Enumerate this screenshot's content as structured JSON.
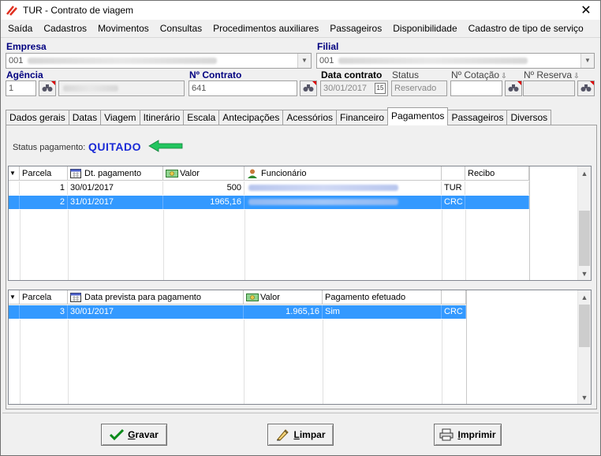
{
  "window": {
    "title": "TUR - Contrato de viagem",
    "close_glyph": "✕"
  },
  "menu": [
    "Saída",
    "Cadastros",
    "Movimentos",
    "Consultas",
    "Procedimentos auxiliares",
    "Passageiros",
    "Disponibilidade",
    "Cadastro de tipo de serviço"
  ],
  "form": {
    "empresa_label": "Empresa",
    "empresa_code": "001",
    "filial_label": "Filial",
    "filial_code": "001",
    "agencia_label": "Agência",
    "agencia_value": "1",
    "contrato_label": "Nº Contrato",
    "contrato_value": "641",
    "data_contrato_label": "Data contrato",
    "data_contrato_value": "30/01/2017",
    "calendar_day": "15",
    "status_label": "Status",
    "status_value": "Reservado",
    "cotacao_label": "Nº Cotação",
    "reserva_label": "Nº Reserva"
  },
  "tabs": [
    "Dados gerais",
    "Datas",
    "Viagem",
    "Itinerário",
    "Escala",
    "Antecipações",
    "Acessórios",
    "Financeiro",
    "Pagamentos",
    "Passageiros",
    "Diversos"
  ],
  "active_tab": "Pagamentos",
  "payment": {
    "status_label": "Status pagamento:",
    "status_value": "QUITADO"
  },
  "grid1": {
    "headers": [
      "Parcela",
      "Dt. pagamento",
      "Valor",
      "Funcionário",
      "",
      "Recibo"
    ],
    "rows": [
      {
        "parcela": "1",
        "data": "30/01/2017",
        "valor": "500",
        "tipo": "TUR",
        "selected": false
      },
      {
        "parcela": "2",
        "data": "31/01/2017",
        "valor": "1965,16",
        "tipo": "CRC",
        "selected": true
      }
    ]
  },
  "grid2": {
    "headers": [
      "Parcela",
      "Data prevista para pagamento",
      "Valor",
      "Pagamento efetuado",
      ""
    ],
    "rows": [
      {
        "parcela": "3",
        "data": "30/01/2017",
        "valor": "1.965,16",
        "efetuado": "Sim",
        "tipo": "CRC",
        "selected": true
      }
    ]
  },
  "buttons": {
    "gravar": {
      "underline": "G",
      "rest": "ravar"
    },
    "limpar": {
      "underline": "L",
      "rest": "impar"
    },
    "imprimir": {
      "underline": "I",
      "rest": "mprimir"
    }
  },
  "colors": {
    "accent_blue": "#1a2ad6",
    "selection": "#3399ff",
    "label_navy": "#000080"
  }
}
